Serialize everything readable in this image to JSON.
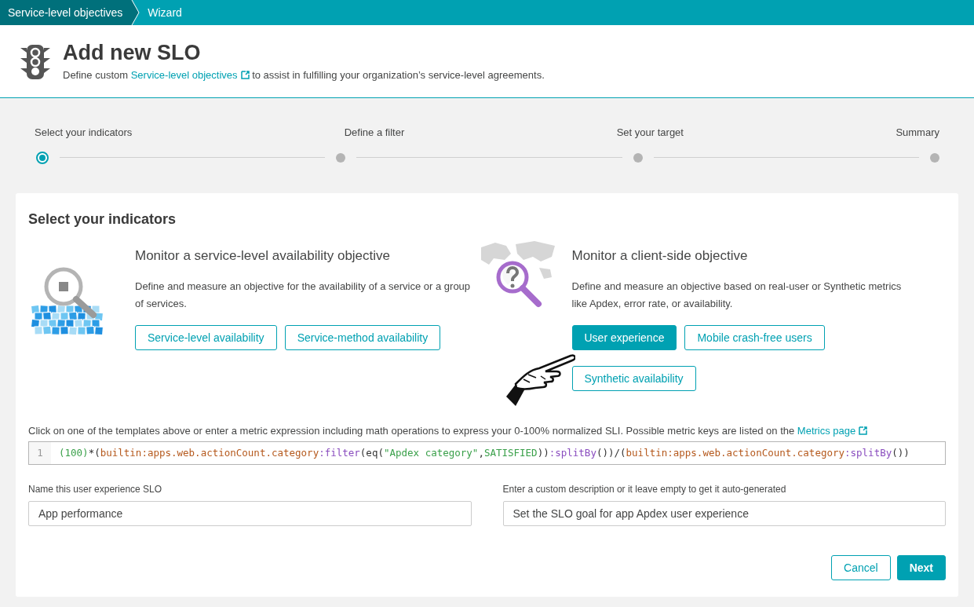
{
  "breadcrumbs": [
    {
      "label": "Service-level objectives",
      "selected": false
    },
    {
      "label": "Wizard",
      "selected": true
    }
  ],
  "header": {
    "title": "Add new SLO",
    "description_before": "Define custom",
    "link": "Service-level objectives",
    "description_after": "to assist in fulfilling your organization’s service-level agreements."
  },
  "steps": [
    {
      "label": "Select your indicators",
      "selected": true
    },
    {
      "label": "Define a filter",
      "selected": false
    },
    {
      "label": "Set your target",
      "selected": false
    },
    {
      "label": "Summary",
      "selected": false
    }
  ],
  "section_title": "Select your indicators",
  "objectives": [
    {
      "kind": "service",
      "title": "Monitor a service-level availability objective",
      "description": "Define and measure an objective for the availability of a service or a group of services.",
      "buttons": [
        {
          "label": "Service-level availability",
          "selected": false
        },
        {
          "label": "Service-method availability",
          "selected": false
        }
      ]
    },
    {
      "kind": "client",
      "title": "Monitor a client-side objective",
      "description": "Define and measure an objective based on real-user or Synthetic metrics like Apdex, error rate, or availability.",
      "buttons": [
        {
          "label": "User experience",
          "selected": true
        },
        {
          "label": "Mobile crash-free users",
          "selected": false
        },
        {
          "label": "Synthetic availability",
          "selected": false
        }
      ]
    }
  ],
  "expression_hint": "Click on one of the templates above or enter a metric expression including math operations to express your 0-100% normalized SLI. Possible metric keys are listed on the",
  "metrics_link": "Metrics page",
  "editor": {
    "line_number": "1",
    "tokens": [
      {
        "kind": "literal",
        "text": "(100)"
      },
      {
        "kind": "plain",
        "text": "*("
      },
      {
        "kind": "metric",
        "text": "builtin:apps.web.actionCount.category"
      },
      {
        "kind": "function",
        "text": ":filter"
      },
      {
        "kind": "plain",
        "text": "(eq("
      },
      {
        "kind": "literal",
        "text": "\"Apdex category\""
      },
      {
        "kind": "plain",
        "text": ","
      },
      {
        "kind": "literal",
        "text": "SATISFIED"
      },
      {
        "kind": "plain",
        "text": "))"
      },
      {
        "kind": "function",
        "text": ":splitBy"
      },
      {
        "kind": "plain",
        "text": "())/("
      },
      {
        "kind": "metric",
        "text": "builtin:apps.web.actionCount.category"
      },
      {
        "kind": "function",
        "text": ":splitBy"
      },
      {
        "kind": "plain",
        "text": "())"
      }
    ]
  },
  "fields": [
    {
      "label": "Name this user experience SLO",
      "value": "App performance"
    },
    {
      "label": "Enter a custom description or it leave empty to get it auto-generated",
      "value": "Set the SLO goal for app Apdex user experience"
    }
  ],
  "actions": [
    {
      "label": "Cancel",
      "kind": "secondary"
    },
    {
      "label": "Next",
      "kind": "primary"
    }
  ]
}
